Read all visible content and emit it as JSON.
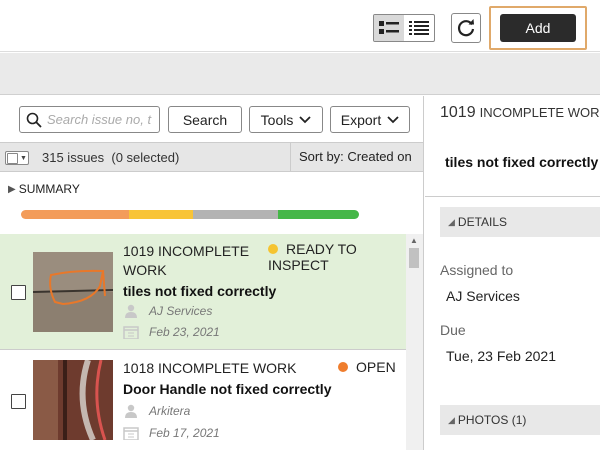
{
  "toolbar": {
    "add_label": "Add",
    "list_view_icon": "list-detail-icon",
    "compact_view_icon": "list-compact-icon",
    "refresh_icon": "refresh-icon"
  },
  "list_toolbar": {
    "search_placeholder": "Search issue no, t",
    "search_button": "Search",
    "tools_button": "Tools",
    "export_button": "Export"
  },
  "list_header": {
    "count_text": "315 issues",
    "selected_text": "(0 selected)",
    "sort_label": "Sort by: Created on"
  },
  "summary": {
    "label": "SUMMARY",
    "progress": [
      {
        "color": "#f39c5a",
        "fraction": 0.32
      },
      {
        "color": "#f8c437",
        "fraction": 0.19
      },
      {
        "color": "#b3b3b3",
        "fraction": 0.25
      },
      {
        "color": "#45b748",
        "fraction": 0.24
      }
    ]
  },
  "issues": [
    {
      "title": "1019 INCOMPLETE WORK",
      "status": "READY TO INSPECT",
      "status_color": "#f5c431",
      "description": "tiles not fixed correctly",
      "assignee": "AJ Services",
      "date": "Feb 23, 2021",
      "selected": true
    },
    {
      "title": "1018 INCOMPLETE WORK",
      "status": "OPEN",
      "status_color": "#ef7d2d",
      "description": "Door Handle not fixed correctly",
      "assignee": "Arkitera",
      "date": "Feb 17, 2021",
      "selected": false
    }
  ],
  "detail": {
    "number": "1019",
    "type": "INCOMPLETE WORK",
    "description": "tiles not fixed correctly",
    "details_header": "DETAILS",
    "assigned_label": "Assigned to",
    "assigned_value": "AJ Services",
    "due_label": "Due",
    "due_value": "Tue, 23 Feb 2021",
    "photos_header": "PHOTOS (1)"
  }
}
